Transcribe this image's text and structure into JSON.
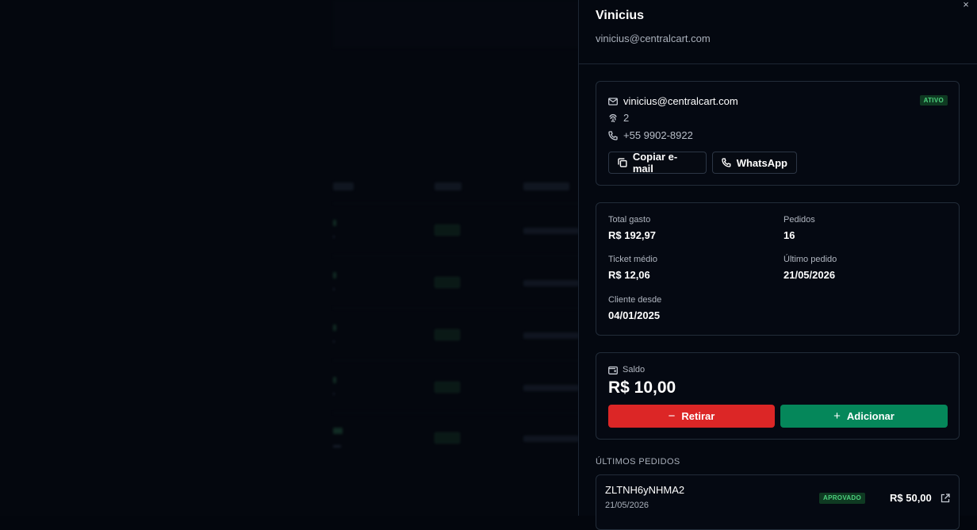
{
  "drawer": {
    "close_label": "×",
    "customer": {
      "name": "Vinicius",
      "email": "vinicius@centralcart.com"
    },
    "contact": {
      "email": "vinicius@centralcart.com",
      "id": "2",
      "phone": "+55 9902-8922",
      "status": "ATIVO",
      "copy_email_label": "Copiar e-mail",
      "whatsapp_label": "WhatsApp",
      "icons": [
        "mail-icon",
        "fingerprint-icon",
        "phone-icon",
        "copy-icon"
      ]
    },
    "stats": {
      "total_spent_label": "Total gasto",
      "total_spent": "R$ 192,97",
      "orders_label": "Pedidos",
      "orders": "16",
      "avg_ticket_label": "Ticket médio",
      "avg_ticket": "R$ 12,06",
      "last_order_label": "Último pedido",
      "last_order": "21/05/2026",
      "customer_since_label": "Cliente desde",
      "customer_since": "04/01/2025"
    },
    "balance": {
      "label": "Saldo",
      "value": "R$ 10,00",
      "withdraw_label": "Retirar",
      "add_label": "Adicionar",
      "withdraw_symbol": "−",
      "add_symbol": "+",
      "withdraw_color": "#dc2626",
      "add_color": "#05875a"
    },
    "recent_orders": {
      "title": "ÚLTIMOS PEDIDOS",
      "items": [
        {
          "id": "ZLTNH6yNHMA2",
          "date": "21/05/2026",
          "status": "APROVADO",
          "amount": "R$ 50,00"
        }
      ]
    }
  },
  "colors": {
    "background": "#03060d",
    "panel": "#040810",
    "border": "#222c39",
    "status_green": "#4cd07d"
  }
}
